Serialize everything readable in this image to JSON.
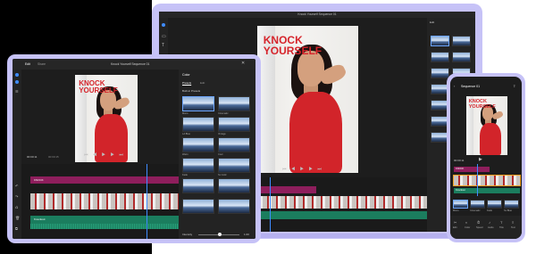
{
  "preview_title": "KNOCK YOURSELF",
  "laptop": {
    "title": "Knock Yourself Sequence 01",
    "panel_label": "Edit",
    "timecode_a": "00:00:11",
    "timecode_b": "00:00:15"
  },
  "tablet": {
    "tab_edit": "Edit",
    "tab_share": "Share",
    "title": "Knock Yourself Sequence 01",
    "panel_title": "Color",
    "panel_tab_presets": "Presets",
    "panel_tab_edit": "Edit",
    "presets_heading": "Built-in Presets",
    "preset_labels": [
      "Mono",
      "Cinematic",
      "LA Blue",
      "Vintage",
      "Warm",
      "Cool",
      "Fade",
      "SL Gold"
    ],
    "timecode_a": "00:00:11",
    "timecode_b": "00:00:15",
    "title_track": "KNOCK",
    "audio_track": "Knockout",
    "intensity_label": "Intensity",
    "intensity_value": "1.00"
  },
  "phone": {
    "title": "Sequence 01",
    "timecode": "00:00:11",
    "title_track": "KNOCK",
    "audio_track": "Knockout",
    "preset_labels": [
      "Mono",
      "Cinematic",
      "Fade",
      "SL Blue"
    ],
    "tabs": [
      "Edit",
      "Color",
      "Speed",
      "Audio",
      "Title",
      "Text"
    ]
  },
  "colors": {
    "accent": "#3f8cff",
    "device_frame": "#c6c2f7",
    "title_red": "#d6242b",
    "title_track": "#8e1e5c",
    "audio_track": "#1b7d5e"
  }
}
